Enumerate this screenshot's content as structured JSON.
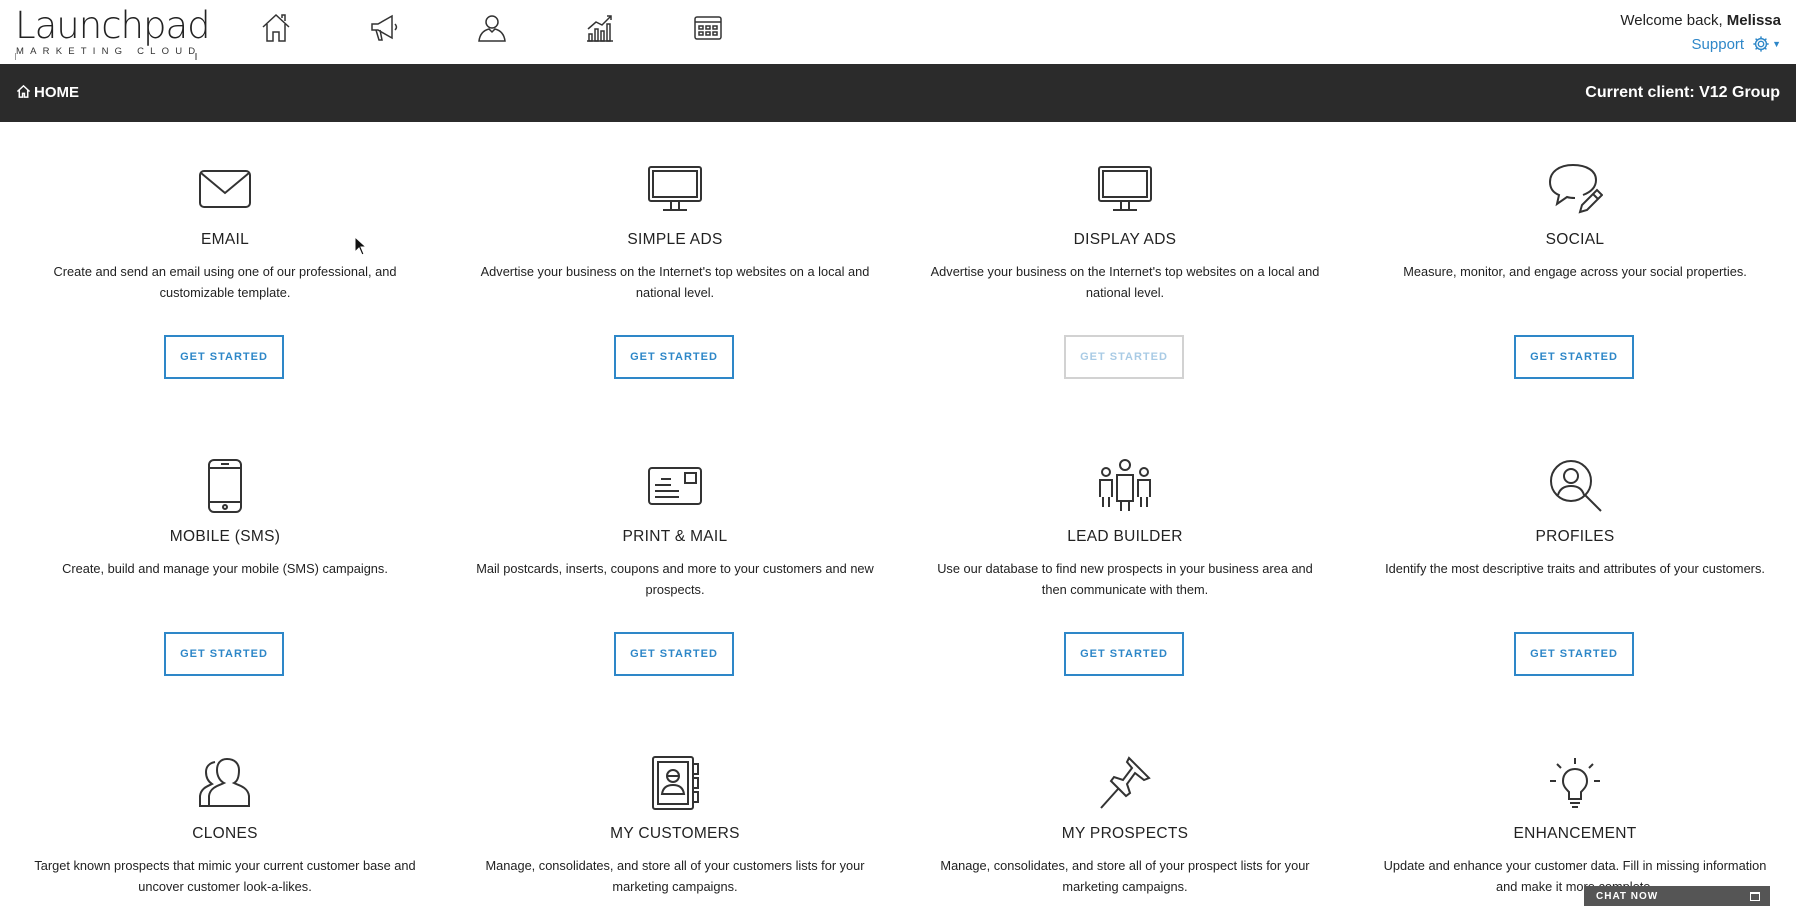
{
  "logo": {
    "main": "Launchpad",
    "sub": "MARKETING CLOUD"
  },
  "nav": [
    {
      "icon": "home-icon"
    },
    {
      "icon": "megaphone-icon"
    },
    {
      "icon": "users-icon"
    },
    {
      "icon": "analytics-chart-icon"
    },
    {
      "icon": "calendar-grid-icon"
    }
  ],
  "header": {
    "welcome_prefix": "Welcome back,",
    "user_name": "Melissa",
    "support_label": "Support"
  },
  "breadcrumb": {
    "label": "HOME"
  },
  "client": {
    "label": "Current client: V12 Group"
  },
  "button_label": "GET STARTED",
  "tiles": [
    {
      "title": "EMAIL",
      "desc": "Create and send an email using one of our professional, and customizable template.",
      "icon": "envelope-icon"
    },
    {
      "title": "SIMPLE ADS",
      "desc": "Advertise your business on the Internet's top websites on a local and national level.",
      "icon": "monitor-icon"
    },
    {
      "title": "DISPLAY ADS",
      "desc": "Advertise your business on the Internet's top websites on a local and national level.",
      "icon": "monitor-icon",
      "disabled": true
    },
    {
      "title": "SOCIAL",
      "desc": "Measure, monitor, and engage across your social properties.",
      "icon": "speech-bubble-pencil-icon"
    },
    {
      "title": "MOBILE (SMS)",
      "desc": "Create, build and manage your mobile (SMS) campaigns.",
      "icon": "smartphone-icon"
    },
    {
      "title": "PRINT & MAIL",
      "desc": "Mail postcards, inserts, coupons and more to your customers and new prospects.",
      "icon": "postcard-icon"
    },
    {
      "title": "LEAD BUILDER",
      "desc": "Use our database to find new prospects in your business area and then communicate with them.",
      "icon": "people-group-icon"
    },
    {
      "title": "PROFILES",
      "desc": "Identify the most descriptive traits and attributes of your customers.",
      "icon": "magnifier-person-icon"
    },
    {
      "title": "CLONES",
      "desc": "Target known prospects that mimic your current customer base and uncover customer look-a-likes.",
      "icon": "two-persons-icon"
    },
    {
      "title": "MY CUSTOMERS",
      "desc": "Manage, consolidates, and store all of your customers lists for your marketing campaigns.",
      "icon": "address-book-icon"
    },
    {
      "title": "MY PROSPECTS",
      "desc": "Manage, consolidates, and store all of your prospect lists for your marketing campaigns.",
      "icon": "pushpin-icon"
    },
    {
      "title": "ENHANCEMENT",
      "desc": "Update and enhance your customer data. Fill in missing information and make it more complete.",
      "icon": "lightbulb-icon"
    }
  ],
  "chat": {
    "label": "CHAT NOW"
  },
  "colors": {
    "accent": "#2e87c8",
    "dark_bar": "#2b2b2b",
    "disabled_border": "#d2d2d2"
  }
}
